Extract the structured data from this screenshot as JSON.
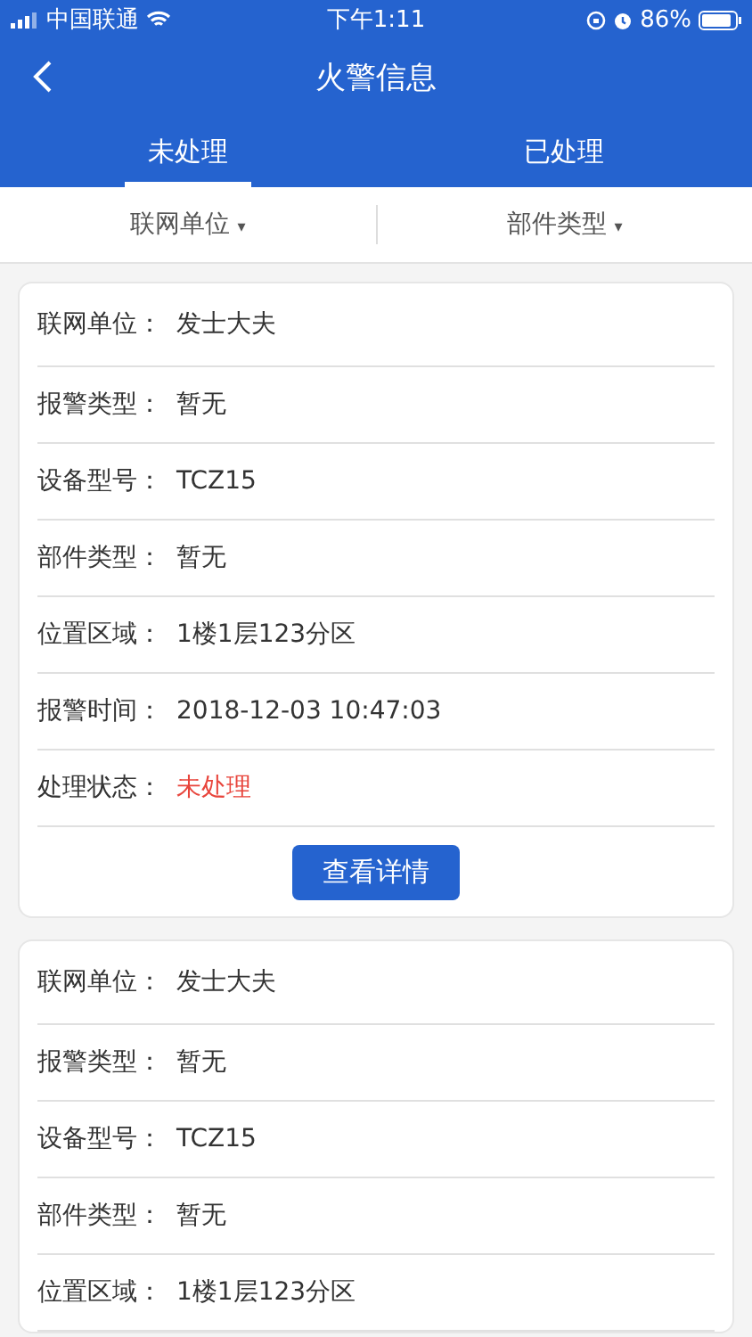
{
  "status_bar": {
    "carrier": "中国联通",
    "time": "下午1:11",
    "battery": "86%"
  },
  "nav": {
    "title": "火警信息"
  },
  "tabs": [
    {
      "label": "未处理",
      "selected": true
    },
    {
      "label": "已处理",
      "selected": false
    }
  ],
  "filters": [
    {
      "label": "联网单位",
      "icon": "▾"
    },
    {
      "label": "部件类型",
      "icon": "▾"
    }
  ],
  "cards": [
    {
      "fields": [
        {
          "label": "联网单位：",
          "value": "发士大夫",
          "kind": "text"
        },
        {
          "label": "报警类型：",
          "value": "暂无",
          "kind": "text"
        },
        {
          "label": "设备型号：",
          "value": "TCZ15",
          "kind": "text"
        },
        {
          "label": "部件类型：",
          "value": "暂无",
          "kind": "text"
        },
        {
          "label": "位置区域：",
          "value": "1楼1层123分区",
          "kind": "text"
        },
        {
          "label": "报警时间：",
          "value": "2018-12-03 10:47:03",
          "kind": "text"
        },
        {
          "label": "处理状态：",
          "value": "未处理",
          "kind": "alert"
        }
      ],
      "button": "查看详情"
    },
    {
      "fields": [
        {
          "label": "联网单位：",
          "value": "发士大夫",
          "kind": "text"
        },
        {
          "label": "报警类型：",
          "value": "暂无",
          "kind": "text"
        },
        {
          "label": "设备型号：",
          "value": "TCZ15",
          "kind": "text"
        },
        {
          "label": "部件类型：",
          "value": "暂无",
          "kind": "text"
        },
        {
          "label": "位置区域：",
          "value": "1楼1层123分区",
          "kind": "text"
        }
      ]
    }
  ]
}
